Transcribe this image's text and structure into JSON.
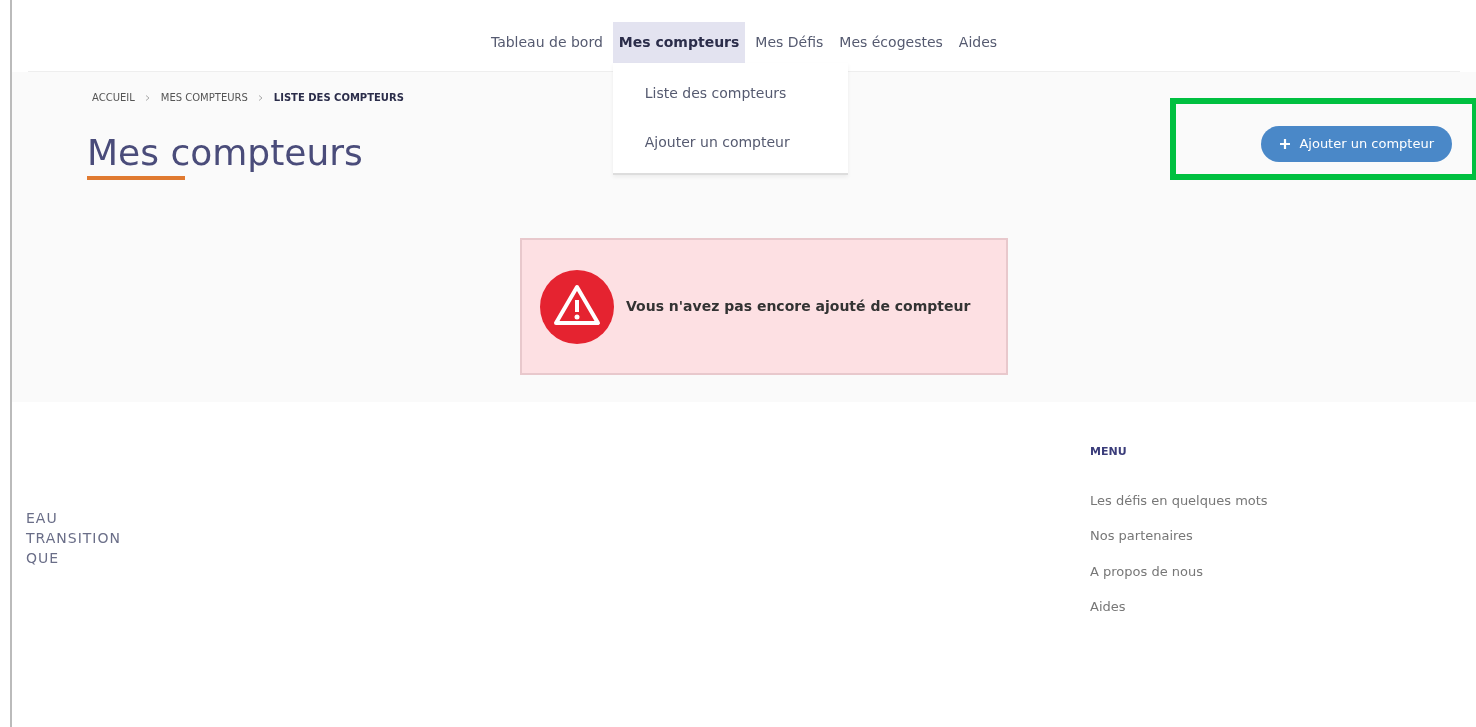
{
  "nav": {
    "items": [
      {
        "label": "Tableau de bord",
        "selected": false
      },
      {
        "label": "Mes compteurs",
        "selected": true,
        "dropdown": [
          "Liste des compteurs",
          "Ajouter un compteur"
        ]
      },
      {
        "label": "Mes Défis",
        "selected": false
      },
      {
        "label": "Mes écogestes",
        "selected": false
      },
      {
        "label": "Aides",
        "selected": false
      }
    ]
  },
  "breadcrumb": [
    {
      "label": "ACCUEIL",
      "current": false
    },
    {
      "label": "MES COMPTEURS",
      "current": false
    },
    {
      "label": "LISTE DES COMPTEURS",
      "current": true
    }
  ],
  "page_title": "Mes compteurs",
  "add_button": {
    "label": "Ajouter un compteur",
    "highlighted": true
  },
  "alert": {
    "message": "Vous n'avez pas encore ajouté de compteur"
  },
  "footer": {
    "brand_lines": [
      "EAU",
      "TRANSITION",
      "QUE"
    ],
    "menu_title": "MENU",
    "menu_items": [
      "Les défis en quelques mots",
      "Nos partenaires",
      "A propos de nous",
      "Aides"
    ]
  }
}
